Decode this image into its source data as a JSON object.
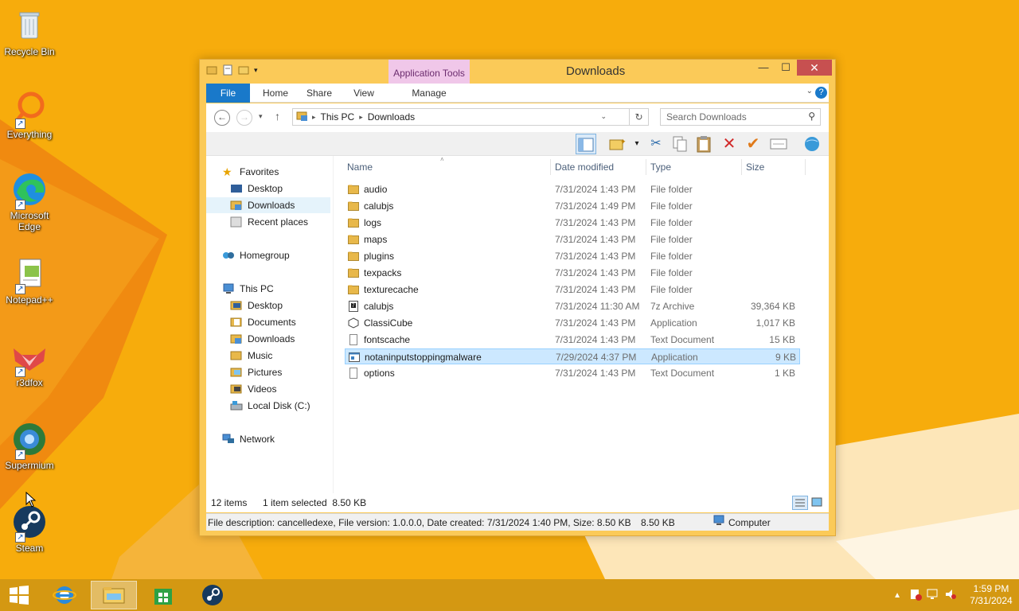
{
  "desktop": {
    "icons": [
      {
        "label": "Recycle Bin",
        "icon": "recycle-bin-icon"
      },
      {
        "label": "Everything",
        "icon": "everything-icon"
      },
      {
        "label": "Microsoft Edge",
        "icon": "edge-icon"
      },
      {
        "label": "Notepad++",
        "icon": "notepadpp-icon"
      },
      {
        "label": "r3dfox",
        "icon": "r3dfox-icon"
      },
      {
        "label": "Supermium",
        "icon": "supermium-icon"
      },
      {
        "label": "Steam",
        "icon": "steam-icon"
      }
    ]
  },
  "window": {
    "title": "Downloads",
    "context_tab": "Application Tools",
    "tabs": [
      "File",
      "Home",
      "Share",
      "View",
      "Manage"
    ],
    "breadcrumb": [
      "This PC",
      "Downloads"
    ],
    "search_placeholder": "Search Downloads",
    "controls": {
      "minimize": "—",
      "maximize": "☐",
      "close": "✕"
    }
  },
  "nav": {
    "favorites": {
      "label": "Favorites",
      "items": [
        "Desktop",
        "Downloads",
        "Recent places"
      ]
    },
    "homegroup": "Homegroup",
    "this_pc": {
      "label": "This PC",
      "items": [
        "Desktop",
        "Documents",
        "Downloads",
        "Music",
        "Pictures",
        "Videos",
        "Local Disk (C:)"
      ]
    },
    "network": "Network"
  },
  "columns": {
    "name": "Name",
    "date": "Date modified",
    "type": "Type",
    "size": "Size"
  },
  "files": [
    {
      "name": "audio",
      "date": "7/31/2024 1:43 PM",
      "type": "File folder",
      "size": "",
      "kind": "folder"
    },
    {
      "name": "calubjs",
      "date": "7/31/2024 1:49 PM",
      "type": "File folder",
      "size": "",
      "kind": "folder"
    },
    {
      "name": "logs",
      "date": "7/31/2024 1:43 PM",
      "type": "File folder",
      "size": "",
      "kind": "folder"
    },
    {
      "name": "maps",
      "date": "7/31/2024 1:43 PM",
      "type": "File folder",
      "size": "",
      "kind": "folder"
    },
    {
      "name": "plugins",
      "date": "7/31/2024 1:43 PM",
      "type": "File folder",
      "size": "",
      "kind": "folder"
    },
    {
      "name": "texpacks",
      "date": "7/31/2024 1:43 PM",
      "type": "File folder",
      "size": "",
      "kind": "folder"
    },
    {
      "name": "texturecache",
      "date": "7/31/2024 1:43 PM",
      "type": "File folder",
      "size": "",
      "kind": "folder"
    },
    {
      "name": "calubjs",
      "date": "7/31/2024 11:30 AM",
      "type": "7z Archive",
      "size": "39,364 KB",
      "kind": "archive"
    },
    {
      "name": "ClassiCube",
      "date": "7/31/2024 1:43 PM",
      "type": "Application",
      "size": "1,017 KB",
      "kind": "classicube"
    },
    {
      "name": "fontscache",
      "date": "7/31/2024 1:43 PM",
      "type": "Text Document",
      "size": "15 KB",
      "kind": "text"
    },
    {
      "name": "notaninputstoppingmalware",
      "date": "7/29/2024 4:37 PM",
      "type": "Application",
      "size": "9 KB",
      "kind": "app",
      "selected": true
    },
    {
      "name": "options",
      "date": "7/31/2024 1:43 PM",
      "type": "Text Document",
      "size": "1 KB",
      "kind": "text"
    }
  ],
  "status": {
    "count": "12 items",
    "selection": "1 item selected  8.50 KB"
  },
  "details": {
    "description": "File description: cancelledexe, File version: 1.0.0.0, Date created: 7/31/2024 1:40 PM, Size: 8.50 KB",
    "size": "8.50 KB",
    "location": "Computer"
  },
  "taskbar": {
    "time": "1:59 PM",
    "date": "7/31/2024",
    "items": [
      "start-icon",
      "ie-icon",
      "file-explorer-icon",
      "store-icon",
      "steam-icon"
    ]
  },
  "colors": {
    "accent": "#1979ca",
    "selection": "#cce8ff",
    "wallpaper": "#f6a800"
  }
}
